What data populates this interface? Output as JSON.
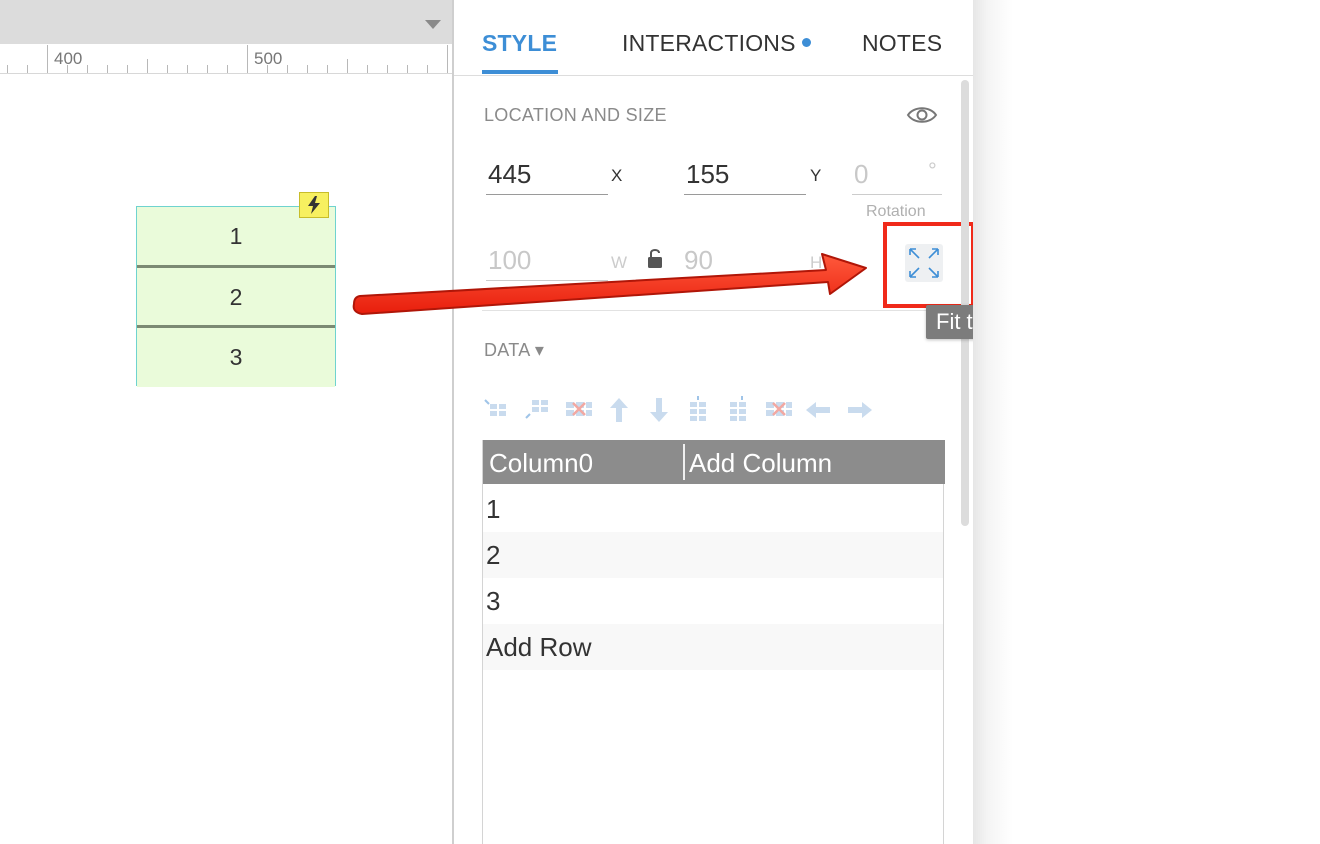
{
  "ruler": {
    "labels": [
      "400",
      "500"
    ]
  },
  "widget": {
    "rows": [
      "1",
      "2",
      "3"
    ],
    "bolt_icon": "lightning-bolt-icon"
  },
  "tabs": {
    "style": "STYLE",
    "interactions": "INTERACTIONS",
    "notes": "NOTES"
  },
  "location_size": {
    "title": "LOCATION AND SIZE",
    "x_value": "445",
    "x_unit": "X",
    "y_value": "155",
    "y_unit": "Y",
    "rotation_value": "0",
    "rotation_unit": "°",
    "rotation_caption": "Rotation",
    "w_value": "100",
    "w_unit": "W",
    "h_value": "90",
    "h_unit": "H"
  },
  "tooltip": {
    "text": "Fit to Content in HTML"
  },
  "data_section": {
    "title": "DATA ▾",
    "columns": [
      "Column0",
      "Add Column"
    ],
    "rows": [
      "1",
      "2",
      "3",
      "Add Row"
    ]
  },
  "colors": {
    "accent": "#3d8ed6",
    "annotation_red": "#f02a1a",
    "widget_fill": "#eafbda",
    "widget_border": "#6fd3cf"
  }
}
